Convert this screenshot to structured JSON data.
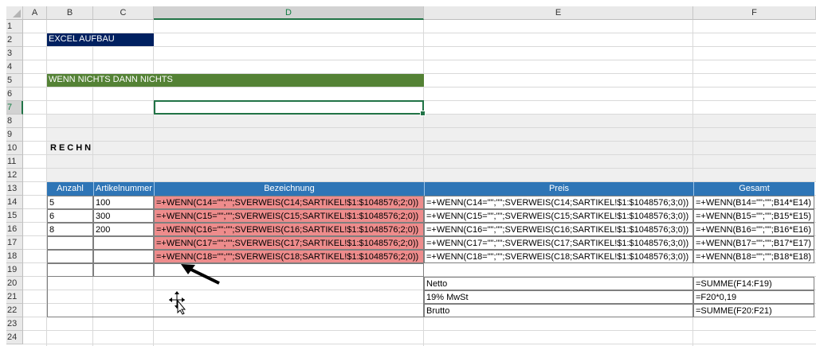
{
  "sheet": {
    "columns": [
      "A",
      "B",
      "C",
      "D",
      "E",
      "F"
    ],
    "rows": [
      "1",
      "2",
      "3",
      "4",
      "5",
      "6",
      "7",
      "8",
      "9",
      "10",
      "11",
      "12",
      "13",
      "14",
      "15",
      "16",
      "17",
      "18",
      "19",
      "20",
      "21",
      "22",
      "23",
      "24"
    ]
  },
  "banners": {
    "title": "EXCEL AUFBAU",
    "subtitle": "WENN NICHTS DANN NICHTS",
    "title_color": "#002060",
    "subtitle_color": "#548235"
  },
  "heading": "RECHN",
  "table": {
    "headers": [
      "Anzahl",
      "Artikelnummer",
      "Bezeichnung",
      "Preis",
      "Gesamt"
    ],
    "header_color": "#2e75b6",
    "highlight_color": "#ee8c8c",
    "rows": [
      {
        "anzahl": "5",
        "artikel": "100",
        "bezeichnung": "=+WENN(C14=\"\";\"\";SVERWEIS(C14;SARTIKEL!$1:$1048576;2;0))",
        "preis": "=+WENN(C14=\"\";\"\";SVERWEIS(C14;SARTIKEL!$1:$1048576;3;0))",
        "gesamt": "=+WENN(B14=\"\";\"\";B14*E14)"
      },
      {
        "anzahl": "6",
        "artikel": "300",
        "bezeichnung": "=+WENN(C15=\"\";\"\";SVERWEIS(C15;SARTIKEL!$1:$1048576;2;0))",
        "preis": "=+WENN(C15=\"\";\"\";SVERWEIS(C15;SARTIKEL!$1:$1048576;3;0))",
        "gesamt": "=+WENN(B15=\"\";\"\";B15*E15)"
      },
      {
        "anzahl": "8",
        "artikel": "200",
        "bezeichnung": "=+WENN(C16=\"\";\"\";SVERWEIS(C16;SARTIKEL!$1:$1048576;2;0))",
        "preis": "=+WENN(C16=\"\";\"\";SVERWEIS(C16;SARTIKEL!$1:$1048576;3;0))",
        "gesamt": "=+WENN(B16=\"\";\"\";B16*E16)"
      },
      {
        "anzahl": "",
        "artikel": "",
        "bezeichnung": "=+WENN(C17=\"\";\"\";SVERWEIS(C17;SARTIKEL!$1:$1048576;2;0))",
        "preis": "=+WENN(C17=\"\";\"\";SVERWEIS(C17;SARTIKEL!$1:$1048576;3;0))",
        "gesamt": "=+WENN(B17=\"\";\"\";B17*E17)"
      },
      {
        "anzahl": "",
        "artikel": "",
        "bezeichnung": "=+WENN(C18=\"\";\"\";SVERWEIS(C18;SARTIKEL!$1:$1048576;2;0))",
        "preis": "=+WENN(C18=\"\";\"\";SVERWEIS(C18;SARTIKEL!$1:$1048576;3;0))",
        "gesamt": "=+WENN(B18=\"\";\"\";B18*E18)"
      }
    ]
  },
  "summary": [
    {
      "label": "Netto",
      "value": "=SUMME(F14:F19)"
    },
    {
      "label": "19% MwSt",
      "value": "=F20*0,19"
    },
    {
      "label": "Brutto",
      "value": "=SUMME(F20:F21)"
    }
  ],
  "icons": {
    "annotation_arrow": "arrow-icon",
    "cursor": "move-cursor-icon"
  }
}
